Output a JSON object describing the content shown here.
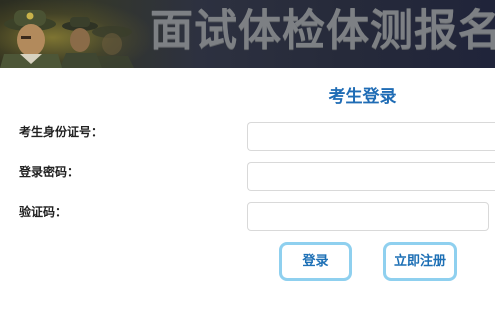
{
  "banner": {
    "title": "面试体检体测报名"
  },
  "login": {
    "heading": "考生登录",
    "fields": [
      {
        "label": "考生身份证号：",
        "value": "",
        "placeholder": ""
      },
      {
        "label": "登录密码：",
        "value": "",
        "placeholder": ""
      },
      {
        "label": "验证码：",
        "value": "",
        "placeholder": ""
      }
    ],
    "buttons": {
      "login": "登录",
      "register": "立即注册"
    }
  },
  "colors": {
    "heading": "#1f6cb5",
    "button_text": "#1c6fb5",
    "button_border": "#8fd0ef",
    "banner_title": "#7d8084"
  }
}
